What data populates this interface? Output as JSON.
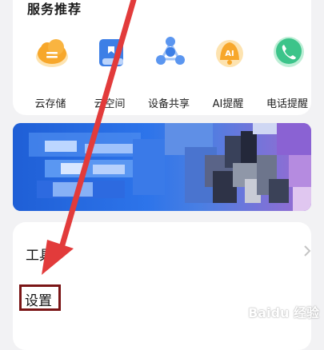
{
  "services": {
    "title": "服务推荐",
    "items": [
      {
        "label": "云存储",
        "icon": "cloud-storage-icon",
        "color": "#f5a623"
      },
      {
        "label": "云空间",
        "icon": "book-icon",
        "color": "#3d7fe6"
      },
      {
        "label": "设备共享",
        "icon": "share-nodes-icon",
        "color": "#3d7fe6"
      },
      {
        "label": "AI提醒",
        "icon": "ai-bell-icon",
        "color": "#f5a623"
      },
      {
        "label": "电话提醒",
        "icon": "phone-icon",
        "color": "#3cc48a"
      }
    ]
  },
  "menu": {
    "tools_label": "工具",
    "settings_label": "设置"
  },
  "watermark": {
    "text": "Baidu 经验"
  },
  "colors": {
    "highlight_border": "#7a1516",
    "annotation_arrow": "#e23b3b"
  }
}
